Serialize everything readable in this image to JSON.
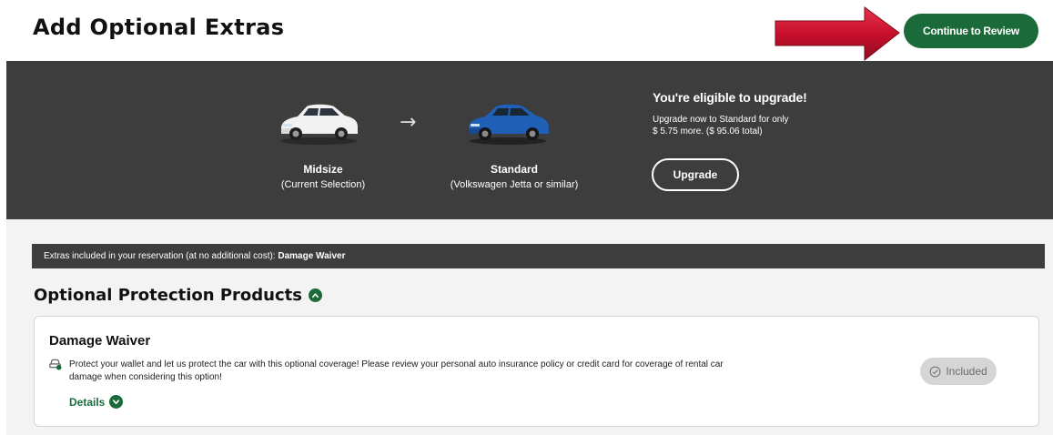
{
  "header": {
    "title": "Add Optional Extras",
    "continue_label": "Continue to Review"
  },
  "upgrade": {
    "current_car_name": "Midsize",
    "current_car_sub": "(Current Selection)",
    "target_car_name": "Standard",
    "target_car_sub": "(Volkswagen Jetta or similar)",
    "arrow_glyph": "→",
    "eligible_title": "You're eligible to upgrade!",
    "eligible_line1": "Upgrade now to Standard for only",
    "eligible_line2": "$ 5.75 more. ($ 95.06 total)",
    "upgrade_label": "Upgrade"
  },
  "included_bar": {
    "prefix": "Extras included in your reservation (at no additional cost):",
    "items": "Damage Waiver"
  },
  "protection": {
    "section_title": "Optional Protection Products",
    "card": {
      "title": "Damage Waiver",
      "description_line1": "Protect your wallet and let us protect the car with this optional coverage! Please review your personal auto insurance policy or credit card for coverage of rental car",
      "description_line2": "damage when considering this option!",
      "details_label": "Details",
      "status_label": "Included"
    }
  },
  "colors": {
    "brand_green": "#1b6b3a",
    "dark_band": "#3d3d3d",
    "arrow_red": "#c8102e"
  }
}
